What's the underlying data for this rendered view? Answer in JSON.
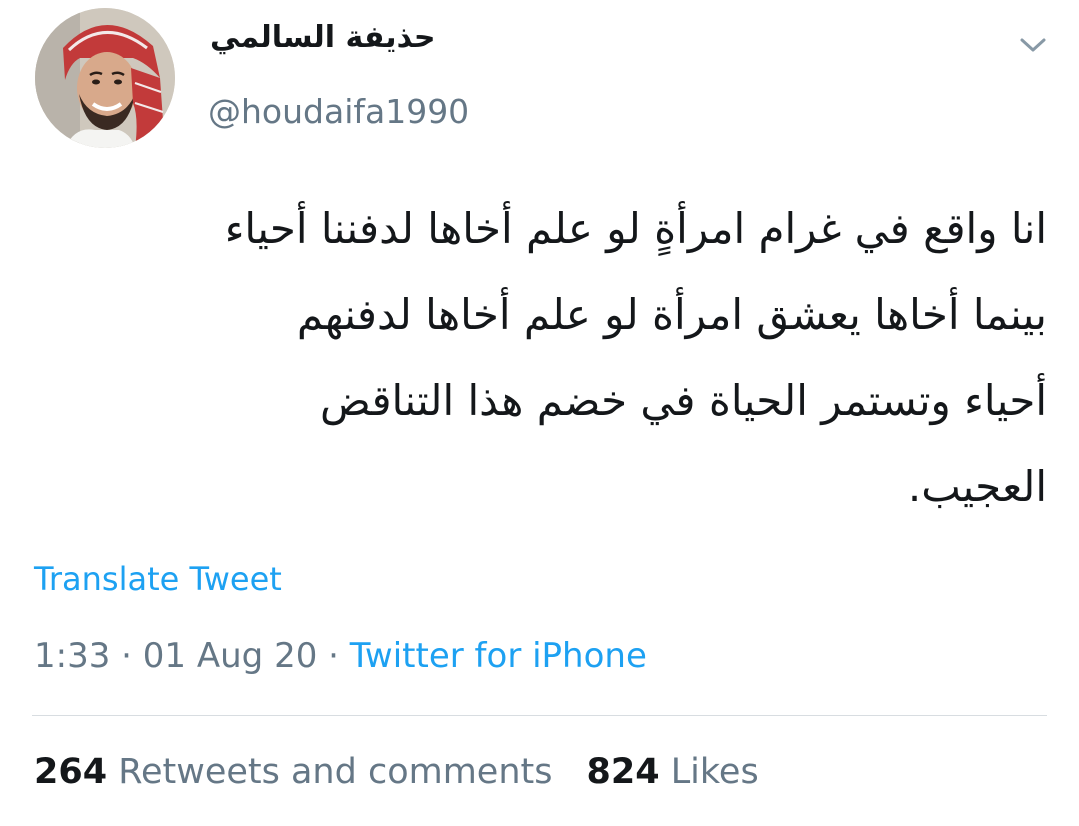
{
  "author": {
    "display_name": "حذيفة السالمي",
    "handle": "@houdaifa1990",
    "avatar_icon": "profile-photo"
  },
  "menu_icon": "chevron-down-icon",
  "tweet": {
    "lines": [
      "انا واقع في غرام امرأةٍ لو علم أخاها لدفننا أحياء",
      "بينما أخاها يعشق امرأة لو علم أخاها لدفنهم",
      "أحياء وتستمر الحياة في خضم هذا التناقض",
      "العجيب."
    ]
  },
  "translate_label": "Translate Tweet",
  "meta": {
    "time": "1:33",
    "sep1": " · ",
    "date": "01 Aug 20",
    "sep2": " · ",
    "source": "Twitter for iPhone"
  },
  "stats": {
    "retweets_count": "264",
    "retweets_label": "Retweets and comments",
    "likes_count": "824",
    "likes_label": "Likes"
  },
  "colors": {
    "text_primary": "#14171a",
    "text_secondary": "#657786",
    "link": "#1da1f2",
    "divider": "#d8dde1"
  }
}
